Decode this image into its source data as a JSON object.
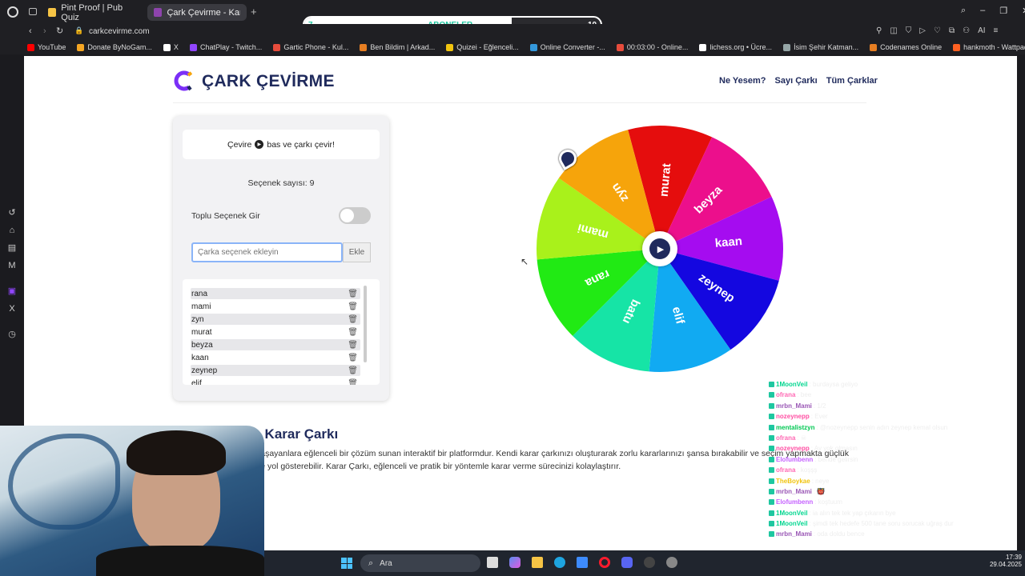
{
  "browser": {
    "tabs": [
      {
        "label": "Pint Proof | Pub Quiz",
        "color": "#f6c445"
      },
      {
        "label": "Çark Çevirme - Karar Çarkı",
        "color": "#8e44ad"
      }
    ],
    "address": "carkcevirme.com",
    "bookmarks": [
      {
        "label": "YouTube",
        "color": "#ff0000"
      },
      {
        "label": "Donate ByNoGam...",
        "color": "#f5a623"
      },
      {
        "label": "X",
        "color": "#ffffff"
      },
      {
        "label": "ChatPlay - Twitch...",
        "color": "#9146ff"
      },
      {
        "label": "Gartic Phone - Kul...",
        "color": "#e74c3c"
      },
      {
        "label": "Ben Bildim | Arkad...",
        "color": "#e67e22"
      },
      {
        "label": "Quizei - Eğlenceli...",
        "color": "#f1c40f"
      },
      {
        "label": "Online Converter -...",
        "color": "#3498db"
      },
      {
        "label": "00:03:00 - Online...",
        "color": "#e74c3c"
      },
      {
        "label": "lichess.org • Ücre...",
        "color": "#ffffff"
      },
      {
        "label": "İsim Şehir Katman...",
        "color": "#95a5a6"
      },
      {
        "label": "Codenames Online",
        "color": "#e67e22"
      },
      {
        "label": "hankmoth - Wattpad",
        "color": "#ff6122"
      }
    ]
  },
  "overlay": {
    "left": "7",
    "label": "ABONELER",
    "right": "10"
  },
  "site": {
    "logo": "ÇARK ÇEVİRME",
    "nav": [
      "Ne Yesem?",
      "Sayı Çarkı",
      "Tüm Çarklar"
    ],
    "instruction_pre": "Çevire",
    "instruction_post": "bas ve çarkı çevir!",
    "option_count": "Seçenek sayısı: 9",
    "bulk_label": "Toplu Seçenek Gir",
    "input_placeholder": "Çarka seçenek ekleyin",
    "add_button": "Ekle",
    "options": [
      "rana",
      "mami",
      "zyn",
      "murat",
      "beyza",
      "kaan",
      "zeynep",
      "elif"
    ],
    "section_title": "e - Karar Çarkı",
    "para1": "yaşayanlara eğlenceli bir çözüm sunan interaktif bir platformdur. Kendi karar çarkınızı oluşturarak zorlu kararlarınızı şansa bırakabilir ve seçim yapmakta güçlük",
    "para2": "ze yol gösterebilir. Karar Çarkı, eğlenceli ve pratik bir yöntemle karar verme sürecinizi kolaylaştırır."
  },
  "wheel": {
    "segments": [
      {
        "label": "murat",
        "color": "#e50d0d"
      },
      {
        "label": "beyza",
        "color": "#ec0f8c"
      },
      {
        "label": "kaan",
        "color": "#a50cf0"
      },
      {
        "label": "zeynep",
        "color": "#1407e0"
      },
      {
        "label": "elif",
        "color": "#11aaf2"
      },
      {
        "label": "batu",
        "color": "#16e4a6"
      },
      {
        "label": "rana",
        "color": "#21ea14"
      },
      {
        "label": "mami",
        "color": "#a9f11b"
      },
      {
        "label": "zyn",
        "color": "#f6a40b"
      }
    ]
  },
  "chat": [
    {
      "user": "1MoonVeil",
      "msg": ": burdaysa geliyo",
      "color": "#00d68f"
    },
    {
      "user": "ofrana",
      "msg": ": bee",
      "color": "#ff69b4"
    },
    {
      "user": "mrbn_Mami",
      "msg": ": 1/2",
      "color": "#9b59b6"
    },
    {
      "user": "nozeynepp",
      "msg": ": Ever",
      "color": "#ff4fa3"
    },
    {
      "user": "mentalistzyn",
      "msg": ": @nozeynepp senin adın zeynep kemal olsun",
      "color": "#00c853"
    },
    {
      "user": "ofrana",
      "msg": ": ☠",
      "color": "#ff69b4"
    },
    {
      "user": "nozeynepp",
      "msg": ": Ay yok olmasın",
      "color": "#ff4fa3"
    },
    {
      "user": "Elofumbenn",
      "msg": ": bende gelirsin",
      "color": "#c561ff"
    },
    {
      "user": "ofrana",
      "msg": ": koşşş",
      "color": "#ff69b4"
    },
    {
      "user": "TheBoykae",
      "msg": ": neye",
      "color": "#f1c40f"
    },
    {
      "user": "mrbn_Mami",
      "msg": ": 👹",
      "color": "#9b59b6"
    },
    {
      "user": "Elofumbenn",
      "msg": ": koştuum",
      "color": "#c561ff"
    },
    {
      "user": "1MoonVeil",
      "msg": ": ia alın tek tek yap çıkarın bye",
      "color": "#00d68f"
    },
    {
      "user": "1MoonVeil",
      "msg": ": şimdi tek hedefe 500 tane soru sorucak uğraş dur",
      "color": "#00d68f"
    },
    {
      "user": "mrbn_Mami",
      "msg": ": oda doldu bence",
      "color": "#9b59b6"
    }
  ],
  "taskbar": {
    "search": "Ara",
    "time": "17:39",
    "date": "29.04.2025"
  }
}
